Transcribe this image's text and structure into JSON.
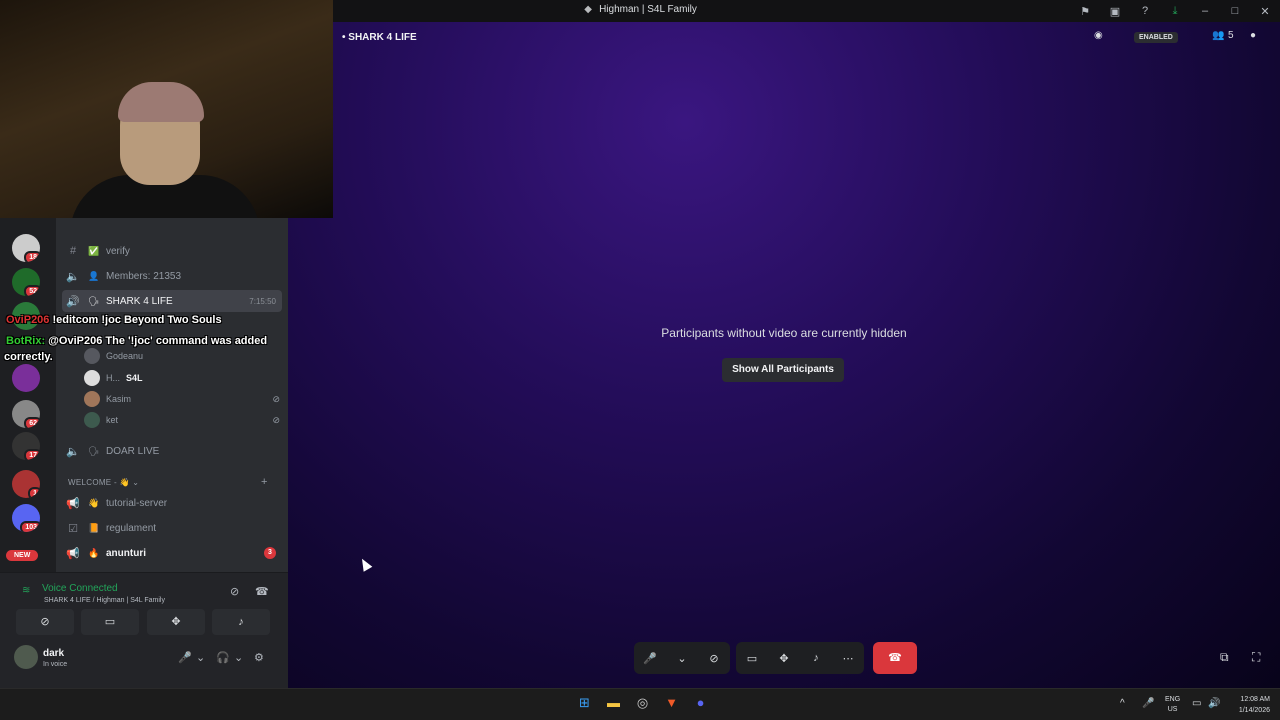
{
  "window": {
    "title": "Highman | S4L Family"
  },
  "titlebar_icons": [
    "flag-icon",
    "inbox-icon",
    "help-icon",
    "download-icon",
    "minimize-icon",
    "maximize-icon",
    "close-icon"
  ],
  "stage": {
    "breadcrumb": "• SHARK 4 LIFE",
    "enabled_label": "ENABLED",
    "participant_count": "5",
    "hint": "Participants without video are currently hidden",
    "show_all_label": "Show All Participants"
  },
  "channels": [
    {
      "name": "verify",
      "emoji": "✅"
    },
    {
      "name": "Members: 21353",
      "emoji": "👤"
    },
    {
      "name": "SHARK 4 LIFE",
      "emoji": "🗣",
      "time": "7:15:50"
    },
    {
      "name": "DOAR LIVE",
      "emoji": "🗣"
    },
    {
      "name": "tutorial-server",
      "emoji": "👋"
    },
    {
      "name": "regulament",
      "emoji": "📙"
    },
    {
      "name": "anunturi",
      "emoji": "🔥",
      "count": "3"
    }
  ],
  "voice_members": [
    {
      "name": "Godeanu"
    },
    {
      "name": "H...",
      "tag": "S4L"
    },
    {
      "name": "Kasim"
    },
    {
      "name": "ket"
    }
  ],
  "category": {
    "label": "WELCOME -"
  },
  "servers": [
    {
      "badge": "18"
    },
    {
      "badge": "52"
    },
    {
      "badge": ""
    },
    {
      "badge": ""
    },
    {
      "badge": "62"
    },
    {
      "badge": "17"
    },
    {
      "badge": "1"
    },
    {
      "badge": "103"
    }
  ],
  "new_label": "NEW",
  "chat_overlay": {
    "line1_user": "OviP206",
    "line1_text": "!editcom !joc Beyond Two Souls",
    "line2_user": "BotRix:",
    "line2_text": "@OviP206 The '!joc' command was added",
    "line2_cont": "correctly."
  },
  "voice_panel": {
    "status": "Voice Connected",
    "location": "SHARK 4 LIFE / Highman | S4L Family"
  },
  "user": {
    "name": "dark",
    "status": "In voice"
  },
  "taskbar": {
    "lang_top": "ENG",
    "lang_bottom": "US",
    "time": "12:08 AM",
    "date": "1/14/2026"
  }
}
